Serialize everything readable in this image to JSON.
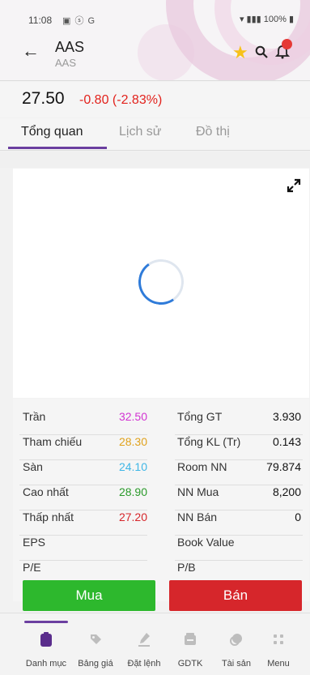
{
  "status_bar": {
    "time": "11:08",
    "left_icons": "▣ ⓢ G",
    "right_text": "100%"
  },
  "header": {
    "symbol": "AAS",
    "subtitle": "AAS"
  },
  "quote": {
    "price": "27.50",
    "change": "-0.80 (-2.83%)"
  },
  "tabs": [
    {
      "label": "Tổng quan",
      "active": true
    },
    {
      "label": "Lịch sử",
      "active": false
    },
    {
      "label": "Đồ thị",
      "active": false
    }
  ],
  "stats": {
    "left": [
      {
        "label": "Trần",
        "value": "32.50",
        "color": "#d234d2"
      },
      {
        "label": "Tham chiếu",
        "value": "28.30",
        "color": "#e0a21c"
      },
      {
        "label": "Sàn",
        "value": "24.10",
        "color": "#3fb6e6"
      },
      {
        "label": "Cao nhất",
        "value": "28.90",
        "color": "#2a9a2a"
      },
      {
        "label": "Thấp nhất",
        "value": "27.20",
        "color": "#d6262b"
      },
      {
        "label": "EPS",
        "value": "",
        "color": "#333333"
      },
      {
        "label": "P/E",
        "value": "",
        "color": "#333333"
      }
    ],
    "right": [
      {
        "label": "Tổng GT",
        "value": "3.930"
      },
      {
        "label": "Tổng KL (Tr)",
        "value": "0.143"
      },
      {
        "label": "Room NN",
        "value": "79.874"
      },
      {
        "label": "NN Mua",
        "value": "8,200"
      },
      {
        "label": "NN Bán",
        "value": "0"
      },
      {
        "label": "Book Value",
        "value": ""
      },
      {
        "label": "P/B",
        "value": ""
      }
    ]
  },
  "actions": {
    "buy": "Mua",
    "sell": "Bán"
  },
  "bottom_nav": [
    {
      "label": "Danh mục",
      "icon": "clipboard-icon",
      "active": true
    },
    {
      "label": "Bảng giá",
      "icon": "tag-icon",
      "active": false
    },
    {
      "label": "Đặt lệnh",
      "icon": "pen-icon",
      "active": false
    },
    {
      "label": "GDTK",
      "icon": "wallet-icon",
      "active": false
    },
    {
      "label": "Tài sản",
      "icon": "coins-icon",
      "active": false
    },
    {
      "label": "Menu",
      "icon": "grid-icon",
      "active": false
    }
  ],
  "colors": {
    "accent": "#6b3fa0",
    "buy": "#2db82d",
    "sell": "#d6262b",
    "down": "#e2221c"
  }
}
